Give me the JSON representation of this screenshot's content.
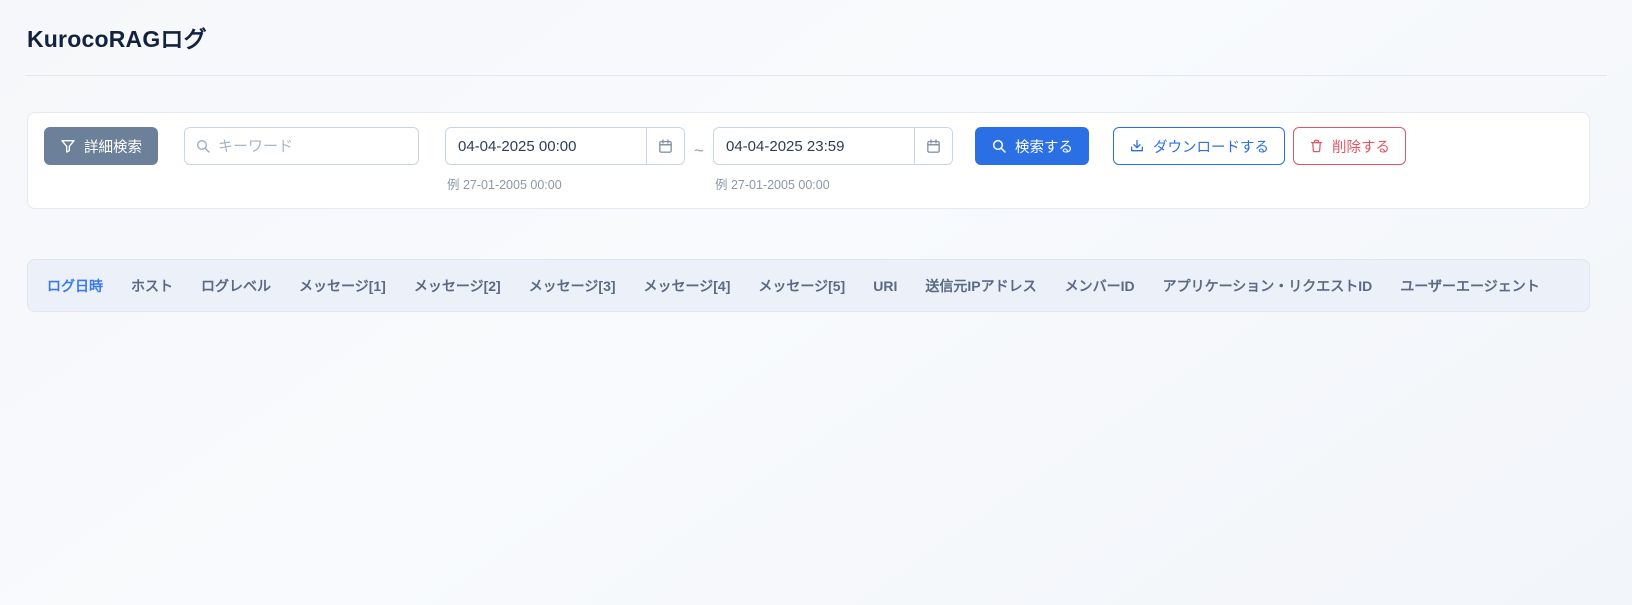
{
  "page": {
    "title": "KurocoRAGログ"
  },
  "toolbar": {
    "advanced_search_label": "詳細検索",
    "keyword_placeholder": "キーワード",
    "date_from": {
      "value": "04-04-2025 00:00",
      "hint": "例 27-01-2005 00:00"
    },
    "date_to": {
      "value": "04-04-2025 23:59",
      "hint": "例 27-01-2005 00:00"
    },
    "range_separator": "~",
    "search_label": "検索する",
    "download_label": "ダウンロードする",
    "delete_label": "削除する"
  },
  "icons": {
    "filter": "funnel-icon",
    "search": "magnifier-icon",
    "calendar": "calendar-icon",
    "download": "download-tray-icon",
    "delete": "trash-icon"
  },
  "colors": {
    "primary_blue": "#2b6fe5",
    "danger_red": "#e25563",
    "advanced_button_slate": "#6c8099",
    "active_column_blue": "#3b79f1",
    "header_bg": "#ecf0f8",
    "page_bg": "#f6f8fb"
  },
  "table": {
    "columns": [
      {
        "label": "ログ日時",
        "active": true
      },
      {
        "label": "ホスト",
        "active": false
      },
      {
        "label": "ログレベル",
        "active": false
      },
      {
        "label": "メッセージ[1]",
        "active": false
      },
      {
        "label": "メッセージ[2]",
        "active": false
      },
      {
        "label": "メッセージ[3]",
        "active": false
      },
      {
        "label": "メッセージ[4]",
        "active": false
      },
      {
        "label": "メッセージ[5]",
        "active": false
      },
      {
        "label": "URI",
        "active": false
      },
      {
        "label": "送信元IPアドレス",
        "active": false
      },
      {
        "label": "メンバーID",
        "active": false
      },
      {
        "label": "アプリケーション・リクエストID",
        "active": false
      },
      {
        "label": "ユーザーエージェント",
        "active": false
      }
    ],
    "rows": []
  }
}
